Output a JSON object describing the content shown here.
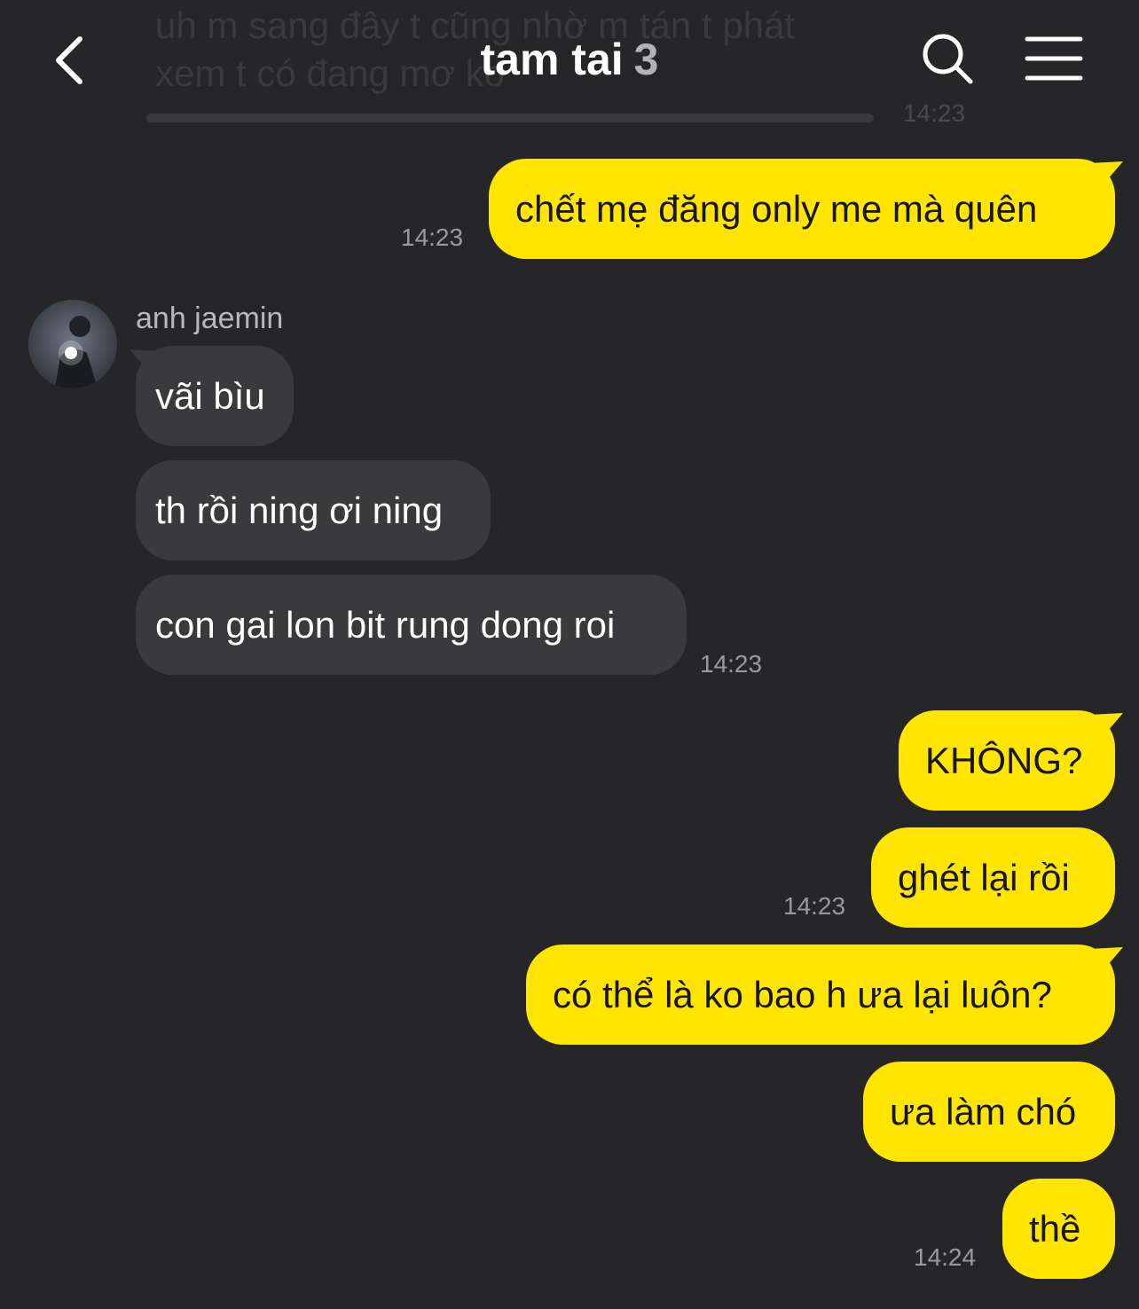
{
  "header": {
    "title": "tam tai",
    "member_count": "3"
  },
  "ghost_message": {
    "lines": [
      "uh m sang đây t cũng nhờ m tán t phát",
      "xem t có đang mơ ko"
    ],
    "time": "14:23"
  },
  "messages": [
    {
      "side": "mine",
      "text": "chết mẹ đăng only me mà quên",
      "time": "14:23"
    },
    {
      "side": "theirs",
      "sender": "anh jaemin",
      "text": "vãi bìu"
    },
    {
      "side": "theirs",
      "text": "th rồi ning ơi ning"
    },
    {
      "side": "theirs",
      "text": "con gai lon bit rung dong roi",
      "time": "14:23"
    },
    {
      "side": "mine",
      "text": "KHÔNG?"
    },
    {
      "side": "mine",
      "text": "ghét lại rồi",
      "time": "14:23"
    },
    {
      "side": "mine",
      "text": "có thể là ko bao h ưa lại luôn?"
    },
    {
      "side": "mine",
      "text": "ưa làm chó"
    },
    {
      "side": "mine",
      "text": "thề",
      "time": "14:24"
    }
  ],
  "colors": {
    "background": "#262628",
    "my_bubble": "#ffe500",
    "their_bubble": "#3a3a3c"
  }
}
